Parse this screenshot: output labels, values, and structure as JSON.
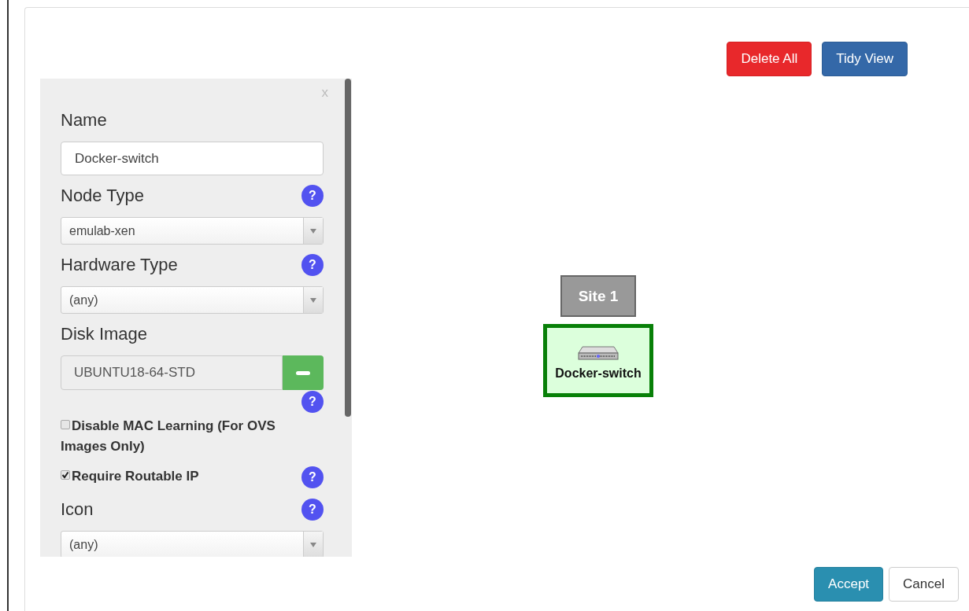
{
  "toolbar": {
    "buttons": [
      {
        "label": "Delete All",
        "kind": "danger"
      },
      {
        "label": "Tidy View",
        "kind": "primary"
      }
    ]
  },
  "panel": {
    "close": "x",
    "fields": [
      {
        "kind": "text",
        "label": "Name",
        "value": "Docker-switch"
      },
      {
        "kind": "select",
        "label": "Node Type",
        "value": "emulab-xen",
        "help": "?"
      },
      {
        "kind": "select",
        "label": "Hardware Type",
        "value": "(any)",
        "help": "?"
      },
      {
        "kind": "image",
        "label": "Disk Image",
        "value": "UBUNTU18-64-STD",
        "help": "?"
      },
      {
        "kind": "checkbox",
        "label": "Disable MAC Learning (For OVS Images Only)",
        "checked": false
      },
      {
        "kind": "checkbox",
        "label": "Require Routable IP",
        "checked": true,
        "help": "?"
      },
      {
        "kind": "select",
        "label": "Icon",
        "value": "(any)",
        "help": "?"
      }
    ]
  },
  "canvas": {
    "site": {
      "label": "Site 1"
    },
    "node": {
      "label": "Docker-switch",
      "selected": true
    }
  },
  "footer": {
    "buttons": [
      {
        "label": "Accept",
        "kind": "accept"
      },
      {
        "label": "Cancel",
        "kind": "cancel"
      }
    ]
  }
}
